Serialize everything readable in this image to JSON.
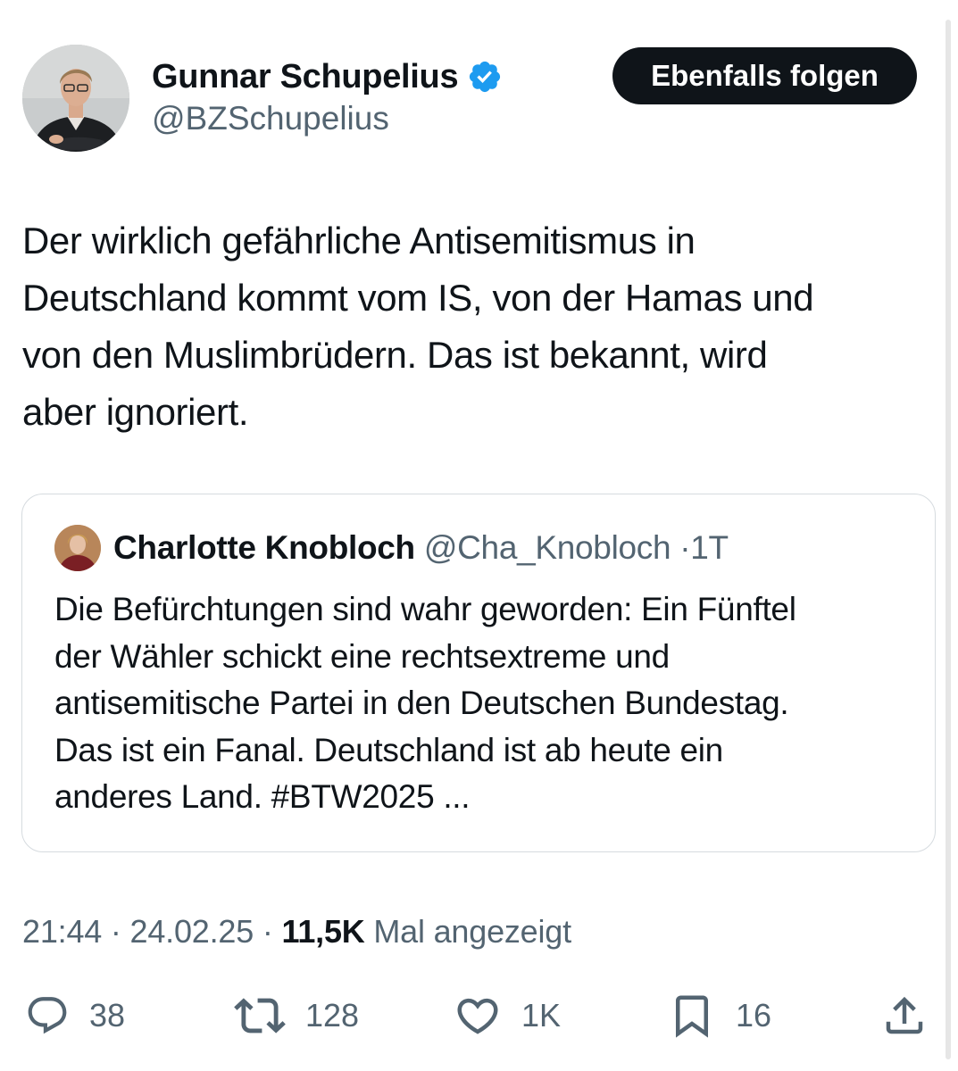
{
  "author": {
    "name": "Gunnar Schupelius",
    "handle": "@BZSchupelius",
    "verified": true
  },
  "follow_button_label": "Ebenfalls folgen",
  "tweet_text": "Der wirklich gefährliche Antisemitismus in\nDeutschland kommt vom IS, von der Hamas und\nvon den Muslimbrüdern. Das ist bekannt, wird\naber ignoriert.",
  "quote": {
    "name": "Charlotte Knobloch",
    "handle": "@Cha_Knobloch",
    "separator": "·",
    "age": "1T",
    "text": "Die Befürchtungen sind wahr geworden: Ein Fünftel\nder Wähler schickt eine rechtsextreme und\nantisemitische Partei in den Deutschen Bundestag.\nDas ist ein Fanal. Deutschland ist ab heute ein\nanderes Land. #BTW2025 ..."
  },
  "meta": {
    "time": "21:44",
    "separator": "·",
    "date": "24.02.25",
    "views": "11,5K",
    "views_label": "Mal angezeigt"
  },
  "actions": {
    "replies": "38",
    "reposts": "128",
    "likes": "1K",
    "bookmarks": "16"
  },
  "icons": {
    "verified": "verified-badge-icon",
    "reply": "reply-icon",
    "repost": "repost-icon",
    "like": "heart-icon",
    "bookmark": "bookmark-icon",
    "share": "share-icon"
  },
  "colors": {
    "text": "#0f1419",
    "secondary": "#536471",
    "verified_blue": "#1d9bf0",
    "border": "#d6dbdf",
    "follow_bg": "#0f1419"
  }
}
